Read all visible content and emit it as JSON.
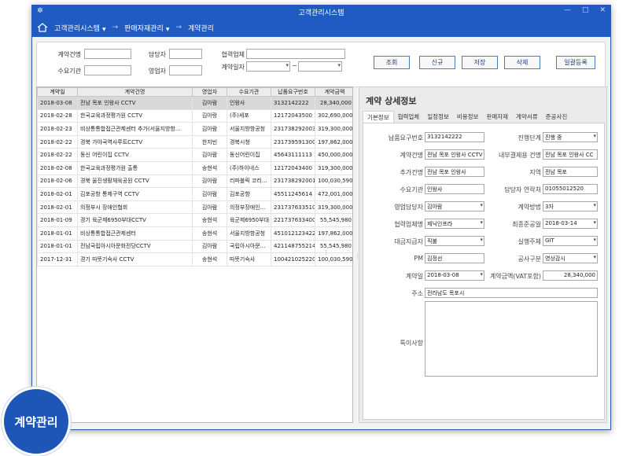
{
  "window": {
    "title": "고객관리시스템",
    "minimize": "—",
    "maximize": "□",
    "close": "✕"
  },
  "breadcrumb": [
    {
      "label": "고객관리시스템",
      "dropdown": true
    },
    {
      "label": "판매자재관리",
      "dropdown": true
    },
    {
      "label": "계약관리",
      "dropdown": false
    }
  ],
  "search": {
    "contract_name_label": "계약건명",
    "client_label": "수요기관",
    "manager_label": "담당자",
    "sales_rep_label": "영업자",
    "partner_label": "협력업체",
    "contract_date_label": "계약일자",
    "date_separator": "~",
    "buttons": {
      "search": "조회",
      "new": "신규",
      "save": "저장",
      "delete": "삭제",
      "bulk": "일괄등록"
    }
  },
  "list": {
    "columns": [
      "계약일",
      "계약건명",
      "영업자",
      "수요기관",
      "납품요구번호",
      "계약금액"
    ],
    "rows": [
      [
        "2018-03-08",
        "전남 목포 인왕사 CCTV",
        "김아람",
        "인왕사",
        "3132142222",
        "28,340,000"
      ],
      [
        "2018-02-28",
        "한국교육과정평가원 CCTV",
        "김아랑",
        "(주)세포",
        "12172043500",
        "302,690,000"
      ],
      [
        "2018-02-23",
        "비상통통합접근관제센터 추가(서울지방항...",
        "김아람",
        "서울지방항공청",
        "231738292003",
        "319,300,000"
      ],
      [
        "2018-02-22",
        "경북 가야국역사루트CCTV",
        "한지빈",
        "경북시청",
        "231739591300",
        "197,862,000"
      ],
      [
        "2018-02-22",
        "동신 어린이집 CCTV",
        "김아람",
        "동신어린이집",
        "45643111113",
        "450,000,000"
      ],
      [
        "2018-02-08",
        "한국교육과정평가원 출통",
        "송현석",
        "(주)하이네스",
        "12172043400",
        "319,300,000"
      ],
      [
        "2018-02-06",
        "경북 울진생활체육공원 CCTV",
        "김아람",
        "리파블릭 코리...",
        "231738292001",
        "100,030,590"
      ],
      [
        "2018-02-01",
        "김포공항 통제구역 CCTV",
        "김아람",
        "김포공항",
        "45511245614",
        "472,001,000"
      ],
      [
        "2018-02-01",
        "의정부시 장애인협회",
        "김아람",
        "의정부장애인...",
        "231737633510",
        "319,300,000"
      ],
      [
        "2018-01-09",
        "경기 육군제6950부대CCTV",
        "송현석",
        "육군제6950부대",
        "221737633400",
        "55,545,980"
      ],
      [
        "2018-01-01",
        "비상통통합접근관제센터",
        "송현석",
        "서울지방항공청",
        "451012123422",
        "197,862,000"
      ],
      [
        "2018-01-01",
        "전남국립아시아문화전당CCTV",
        "김아람",
        "국립아시아문...",
        "421148755214",
        "55,545,980"
      ],
      [
        "2017-12-31",
        "경기 따뜻기숙사 CCTV",
        "송현석",
        "따뜻기숙사",
        "100421025220",
        "100,030,590"
      ]
    ]
  },
  "detail": {
    "title": "계약 상세정보",
    "tabs": [
      "기본정보",
      "협력업체",
      "일정정보",
      "비용정보",
      "판매자재",
      "계약서류",
      "준공사진"
    ],
    "fields": {
      "delivery_no": {
        "label": "납품요구번호",
        "value": "3132142222"
      },
      "progress": {
        "label": "진행단계",
        "value": "진행 중"
      },
      "contract_name": {
        "label": "계약건명",
        "value": "전남 목포 인왕사 CCTV"
      },
      "internal_name": {
        "label": "내부결제용 건명",
        "value": "전남 목포 인왕사 CC"
      },
      "extra_name": {
        "label": "추가건명",
        "value": "전남 목포 인왕사"
      },
      "region": {
        "label": "지역",
        "value": "전남 목포"
      },
      "client": {
        "label": "수요기관",
        "value": "인왕사"
      },
      "manager_contact": {
        "label": "담당자 연락처",
        "value": "01055012520"
      },
      "sales_rep": {
        "label": "영업담당자",
        "value": "김아람"
      },
      "method": {
        "label": "계약방법",
        "value": "3자"
      },
      "partner": {
        "label": "협력업체명",
        "value": "제닉인프라"
      },
      "final_date": {
        "label": "최종준공일",
        "value": "2018-03-14"
      },
      "payer": {
        "label": "대금지급자",
        "value": "직불"
      },
      "executor": {
        "label": "실행주체",
        "value": "GIT"
      },
      "pm": {
        "label": "PM",
        "value": "김정선"
      },
      "work_type": {
        "label": "공사구분",
        "value": "영상감시"
      },
      "contract_date": {
        "label": "계약일",
        "value": "2018-03-08"
      },
      "amount": {
        "label": "계약금액(VAT포함)",
        "value": "28,340,000"
      },
      "address": {
        "label": "주소",
        "value": "전라남도 목포시"
      },
      "memo": {
        "label": "특이사항",
        "value": ""
      }
    }
  },
  "badge": {
    "label": "계약관리"
  }
}
